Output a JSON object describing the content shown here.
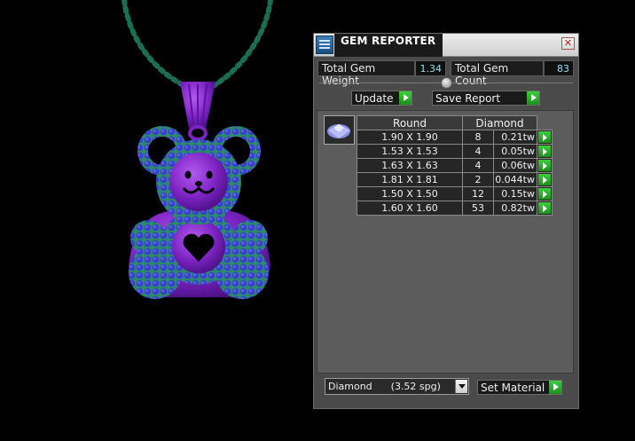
{
  "app": {
    "title": "GEM REPORTER"
  },
  "stats": {
    "total_weight_label": "Total Gem Weight",
    "total_weight_value": "1.34",
    "total_count_label": "Total Gem Count",
    "total_count_value": "83"
  },
  "toolbar": {
    "update_label": "Update",
    "save_report_label": "Save Report"
  },
  "gem_table": {
    "headers": [
      "Round",
      "Diamond"
    ],
    "rows": [
      {
        "size": "1.90 X 1.90",
        "count": "8",
        "weight": "0.21tw"
      },
      {
        "size": "1.53 X 1.53",
        "count": "4",
        "weight": "0.05tw"
      },
      {
        "size": "1.63 X 1.63",
        "count": "4",
        "weight": "0.06tw"
      },
      {
        "size": "1.81 X 1.81",
        "count": "2",
        "weight": "0.044tw"
      },
      {
        "size": "1.50 X 1.50",
        "count": "12",
        "weight": "0.15tw"
      },
      {
        "size": "1.60 X 1.60",
        "count": "53",
        "weight": "0.82tw"
      }
    ]
  },
  "material": {
    "selected": "Diamond      (3.52 spg)",
    "set_label": "Set Material"
  },
  "icons": {
    "app": "gem-reporter-app-icon",
    "close": "close-icon",
    "gem_thumbnail": "round-gem-icon",
    "arrow": "green-arrow-icon",
    "dropdown": "dropdown-arrow-icon"
  },
  "colors": {
    "pendant_metal": "#7b22c2",
    "gem_stones": "#3a3fd0",
    "chain": "#1a6e55",
    "arrow_green": "#2aaf2a",
    "value_text": "#8fe0f0"
  }
}
